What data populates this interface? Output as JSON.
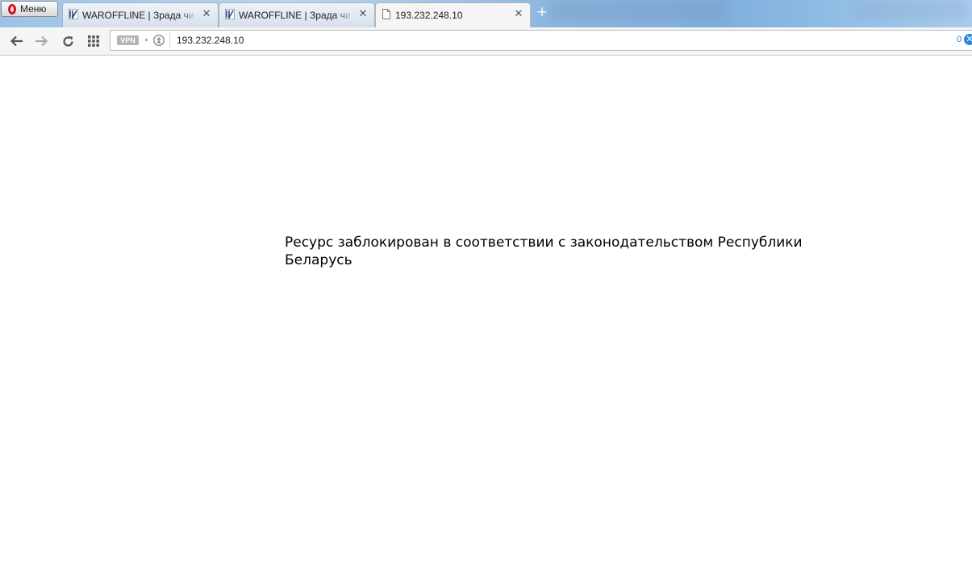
{
  "browser": {
    "menu_label": "Меню",
    "tabs": [
      {
        "title": "WAROFFLINE | Зрада чи Перемога",
        "active": false,
        "favicon": "waroffline-favicon"
      },
      {
        "title": "WAROFFLINE | Зрада чи Перемога",
        "active": false,
        "favicon": "waroffline-favicon"
      },
      {
        "title": "193.232.248.10",
        "active": true,
        "favicon": "page-icon"
      }
    ],
    "new_tab_symbol": "+",
    "close_symbol": "✕"
  },
  "toolbar": {
    "vpn_label": "VPN",
    "url": "193.232.248.10",
    "adblock_count": "0",
    "adblock_symbol": "✕",
    "icons": [
      "back-icon",
      "forward-icon",
      "reload-icon",
      "speed-dial-icon",
      "site-info-icon",
      "adblock-icon"
    ]
  },
  "page": {
    "message": "Ресурс заблокирован в соответствии с законодательством Республики Беларусь"
  },
  "colors": {
    "opera_red": "#d3121f",
    "adblock_blue": "#2c8be0",
    "tabstrip": "#9cc3e6"
  }
}
